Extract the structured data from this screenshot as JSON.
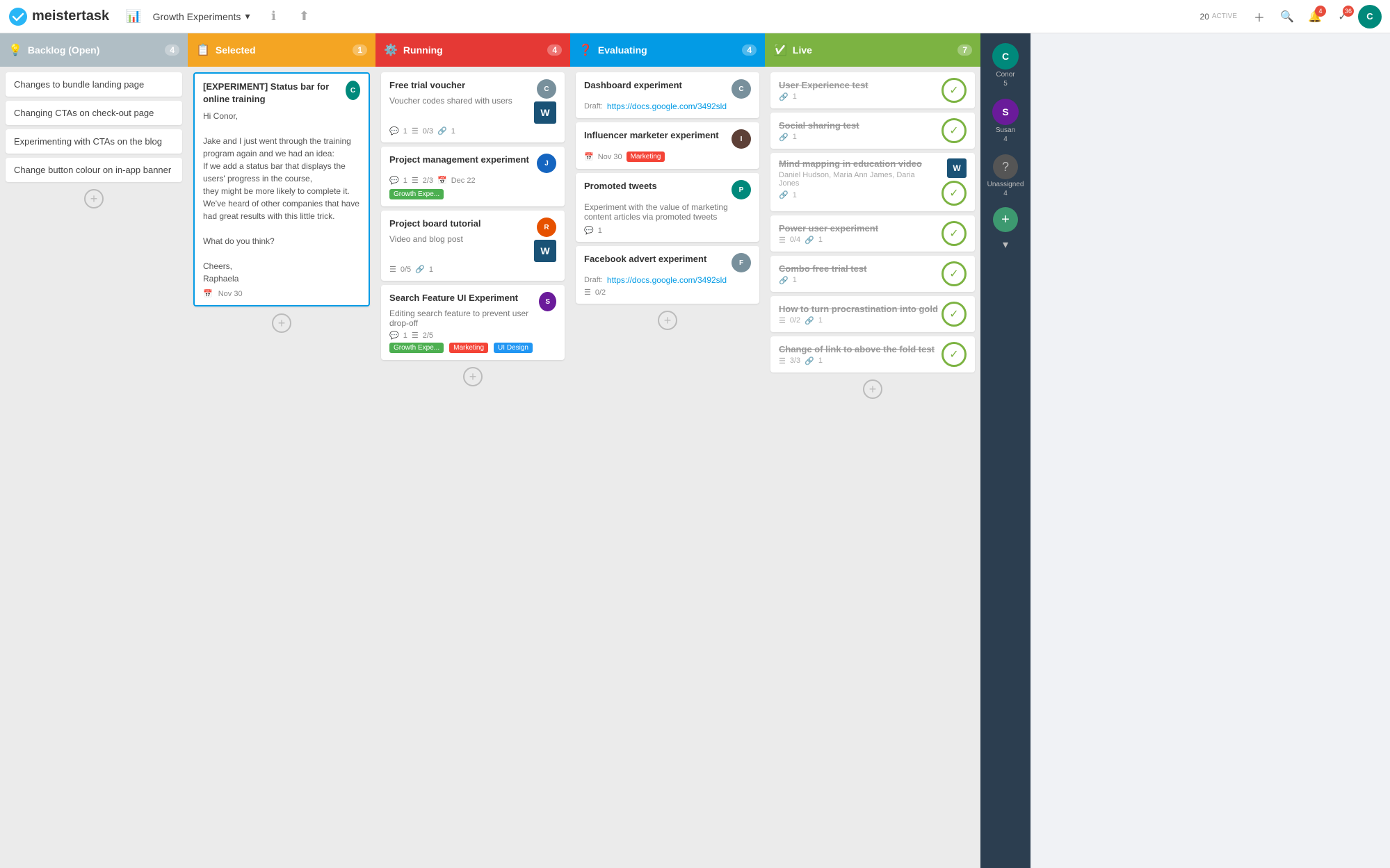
{
  "app": {
    "name": "meistertask",
    "logo_text": "meistertask"
  },
  "topnav": {
    "project_name": "Growth Experiments",
    "active_count": "20",
    "active_label": "ACTIVE",
    "nav_bell_badge": "4",
    "nav_check_badge": "36"
  },
  "columns": {
    "backlog": {
      "label": "Backlog (Open)",
      "count": "4",
      "cards": [
        {
          "title": "Changes to bundle landing page"
        },
        {
          "title": "Changing CTAs on check-out page"
        },
        {
          "title": "Experimenting with CTAs on the blog"
        },
        {
          "title": "Change button colour on in-app banner"
        }
      ],
      "add_label": "+"
    },
    "selected": {
      "label": "Selected",
      "count": "1",
      "cards": [
        {
          "title": "[EXPERIMENT] Status bar for online training",
          "body": "Hi Conor,\n\nJake and I just went through the training program again and we had an idea:\nIf we add a status bar that displays the users' progress in the course,\nthey might be more likely to complete it. We've heard of other companies that have had great results with this little trick.\n\nWhat do you think?\n\nCheers,\nRaphaela",
          "date": "Nov 30",
          "selected": true
        }
      ],
      "add_label": "+"
    },
    "running": {
      "label": "Running",
      "count": "4",
      "cards": [
        {
          "title": "Free trial voucher",
          "subtitle": "Voucher codes shared with users",
          "comments": "1",
          "checklist": "0/3",
          "attachments": "1",
          "has_word_icon": true
        },
        {
          "title": "Project management experiment",
          "comments": "1",
          "checklist": "2/3",
          "date": "Dec 22",
          "tags": [
            "Growth Expe..."
          ],
          "tag_types": [
            "growth"
          ]
        },
        {
          "title": "Project board tutorial",
          "subtitle": "Video and blog post",
          "checklist": "0/5",
          "attachments": "1",
          "has_word_icon": true
        },
        {
          "title": "Search Feature UI Experiment",
          "subtitle": "Editing search feature to prevent user drop-off",
          "comments": "1",
          "checklist": "2/5",
          "tags": [
            "Growth Expe...",
            "Marketing",
            "UI Design"
          ],
          "tag_types": [
            "growth",
            "marketing",
            "uidesign"
          ]
        }
      ],
      "add_label": "+"
    },
    "evaluating": {
      "label": "Evaluating",
      "count": "4",
      "cards": [
        {
          "title": "Dashboard experiment",
          "link": "https://docs.google.com/3492sld"
        },
        {
          "title": "Influencer marketer experiment",
          "date": "Nov 30",
          "tags": [
            "Marketing"
          ],
          "tag_types": [
            "marketing"
          ]
        },
        {
          "title": "Promoted tweets",
          "subtitle": "Experiment with the value of marketing content articles via promoted tweets",
          "comments": "1"
        },
        {
          "title": "Facebook advert experiment",
          "link": "https://docs.google.com/3492sld",
          "checklist": "0/2"
        }
      ],
      "add_label": "+"
    },
    "live": {
      "label": "Live",
      "count": "7",
      "cards": [
        {
          "title": "User Experience test",
          "attachments": "1"
        },
        {
          "title": "Social sharing test",
          "attachments": "1"
        },
        {
          "title": "Mind mapping in education video",
          "assignees": "Daniel Hudson, Maria Ann James, Daria Jones",
          "attachments": "1",
          "has_word_icon": true
        },
        {
          "title": "Power user experiment",
          "checklist": "0/4",
          "attachments": "1"
        },
        {
          "title": "Combo free trial test",
          "attachments": "1"
        },
        {
          "title": "How to turn procrastination into gold",
          "checklist": "0/2",
          "attachments": "1"
        },
        {
          "title": "Change of link to above the fold test",
          "checklist": "3/3",
          "attachments": "1"
        }
      ],
      "add_label": "+"
    }
  },
  "sidebar_users": [
    {
      "name": "Conor",
      "count": "5",
      "initials": "C",
      "color": "av-teal"
    },
    {
      "name": "Susan",
      "count": "4",
      "initials": "S",
      "color": "av-purple"
    },
    {
      "name": "Unassigned",
      "count": "4",
      "initials": "?",
      "color": "av-gray"
    }
  ]
}
